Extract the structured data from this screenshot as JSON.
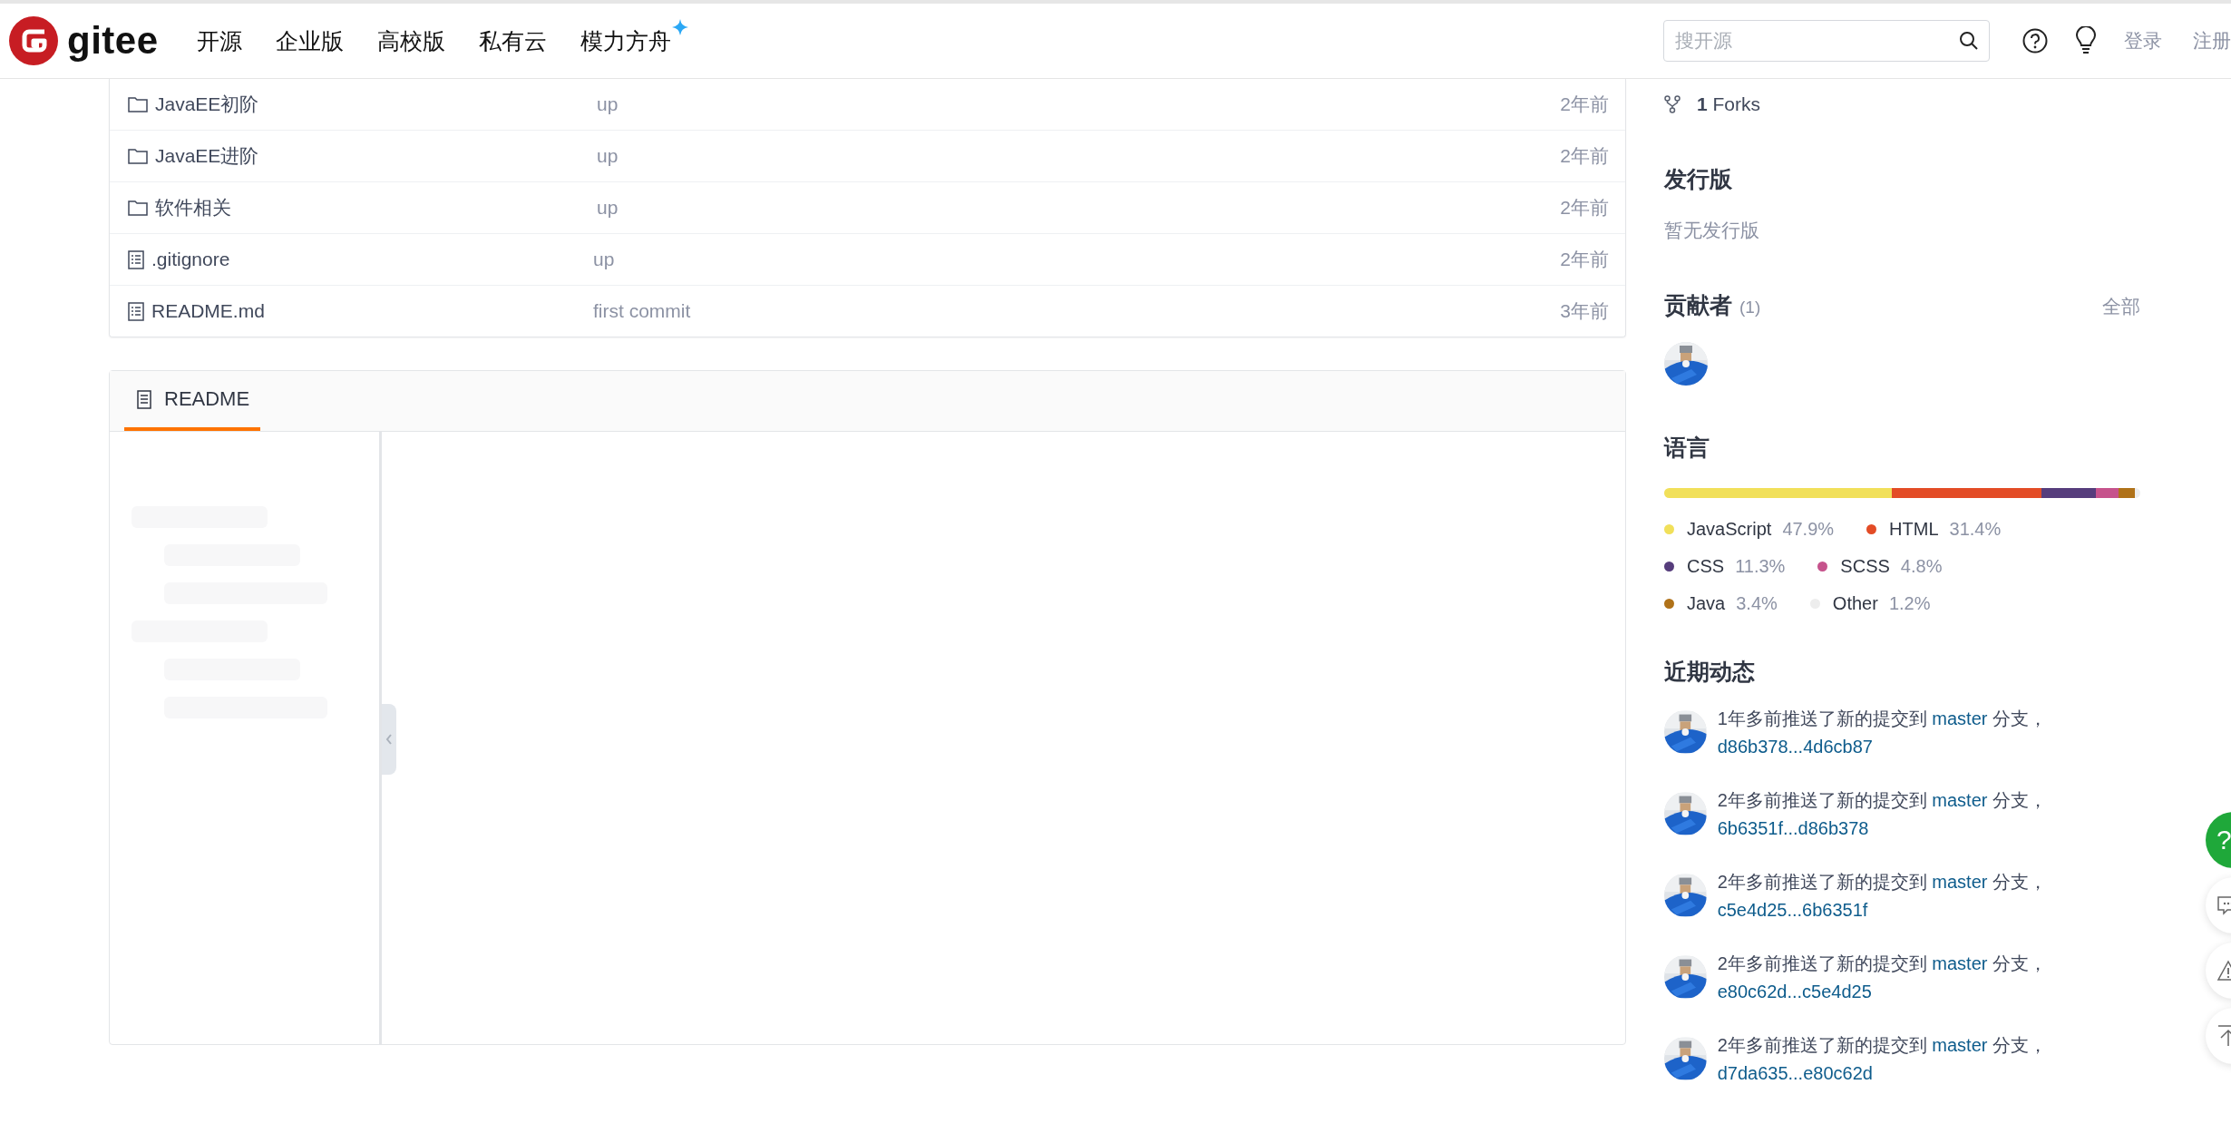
{
  "header": {
    "logo_text": "gitee",
    "nav": [
      {
        "label": "开源",
        "sparkle": false
      },
      {
        "label": "企业版",
        "sparkle": false
      },
      {
        "label": "高校版",
        "sparkle": false
      },
      {
        "label": "私有云",
        "sparkle": false
      },
      {
        "label": "模力方舟",
        "sparkle": true
      }
    ],
    "search": {
      "placeholder": "搜开源"
    },
    "auth": [
      "登录",
      "注册"
    ]
  },
  "files": [
    {
      "kind": "folder",
      "name": "JavaEE初阶",
      "message": "up",
      "time": "2年前"
    },
    {
      "kind": "folder",
      "name": "JavaEE进阶",
      "message": "up",
      "time": "2年前"
    },
    {
      "kind": "folder",
      "name": "软件相关",
      "message": "up",
      "time": "2年前"
    },
    {
      "kind": "file",
      "name": ".gitignore",
      "message": "up",
      "time": "2年前"
    },
    {
      "kind": "file",
      "name": "README.md",
      "message": "first commit",
      "time": "3年前"
    }
  ],
  "readme": {
    "tabs": [
      {
        "label": "README",
        "selected": true
      }
    ]
  },
  "sidebar": {
    "forks": {
      "count": "1",
      "label": "Forks"
    },
    "releases": {
      "title": "发行版",
      "empty": "暂无发行版"
    },
    "contributors": {
      "title": "贡献者",
      "count": "(1)",
      "all": "全部"
    },
    "languages": {
      "title": "语言",
      "items": [
        {
          "name": "JavaScript",
          "percent": "47.9%",
          "color": "#f1e05a"
        },
        {
          "name": "HTML",
          "percent": "31.4%",
          "color": "#e34c26"
        },
        {
          "name": "CSS",
          "percent": "11.3%",
          "color": "#563d7c"
        },
        {
          "name": "SCSS",
          "percent": "4.8%",
          "color": "#c6538c"
        },
        {
          "name": "Java",
          "percent": "3.4%",
          "color": "#b07219"
        },
        {
          "name": "Other",
          "percent": "1.2%",
          "color": "#ededed"
        }
      ]
    },
    "activity": {
      "title": "近期动态",
      "items": [
        {
          "action": "1年多前推送了新的提交到",
          "branch": "master",
          "suffix": "分支，",
          "commit": "d86b378...4d6cb87"
        },
        {
          "action": "2年多前推送了新的提交到",
          "branch": "master",
          "suffix": "分支，",
          "commit": "6b6351f...d86b378"
        },
        {
          "action": "2年多前推送了新的提交到",
          "branch": "master",
          "suffix": "分支，",
          "commit": "c5e4d25...6b6351f"
        },
        {
          "action": "2年多前推送了新的提交到",
          "branch": "master",
          "suffix": "分支，",
          "commit": "e80c62d...c5e4d25"
        },
        {
          "action": "2年多前推送了新的提交到",
          "branch": "master",
          "suffix": "分支，",
          "commit": "d7da635...e80c62d"
        }
      ]
    }
  },
  "float_buttons": [
    {
      "kind": "help",
      "label": "?"
    },
    {
      "kind": "comment"
    },
    {
      "kind": "report"
    },
    {
      "kind": "top"
    }
  ]
}
